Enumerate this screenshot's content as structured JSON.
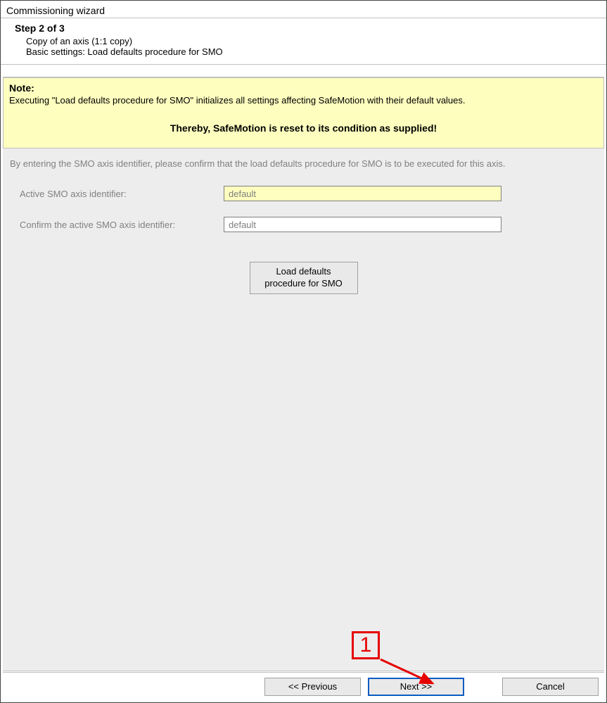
{
  "title": "Commissioning wizard",
  "header": {
    "step": "Step 2 of 3",
    "line1": "Copy of an axis (1:1 copy)",
    "line2": "Basic settings: Load defaults procedure for SMO"
  },
  "note": {
    "title": "Note:",
    "text": "Executing \"Load defaults procedure for SMO\" initializes all settings affecting SafeMotion with their default values.",
    "reset": "Thereby, SafeMotion is reset to its condition as supplied!"
  },
  "instruction": "By entering the SMO axis identifier, please confirm that the load defaults procedure for SMO is to be executed for this axis.",
  "form": {
    "active_label": "Active SMO axis identifier:",
    "active_value": "default",
    "confirm_label": "Confirm the active SMO axis identifier:",
    "confirm_value": "default"
  },
  "load_button": "Load defaults\nprocedure for SMO",
  "buttons": {
    "previous": "<< Previous",
    "next": "Next >>",
    "cancel": "Cancel"
  },
  "annotation": {
    "callout": "1"
  }
}
